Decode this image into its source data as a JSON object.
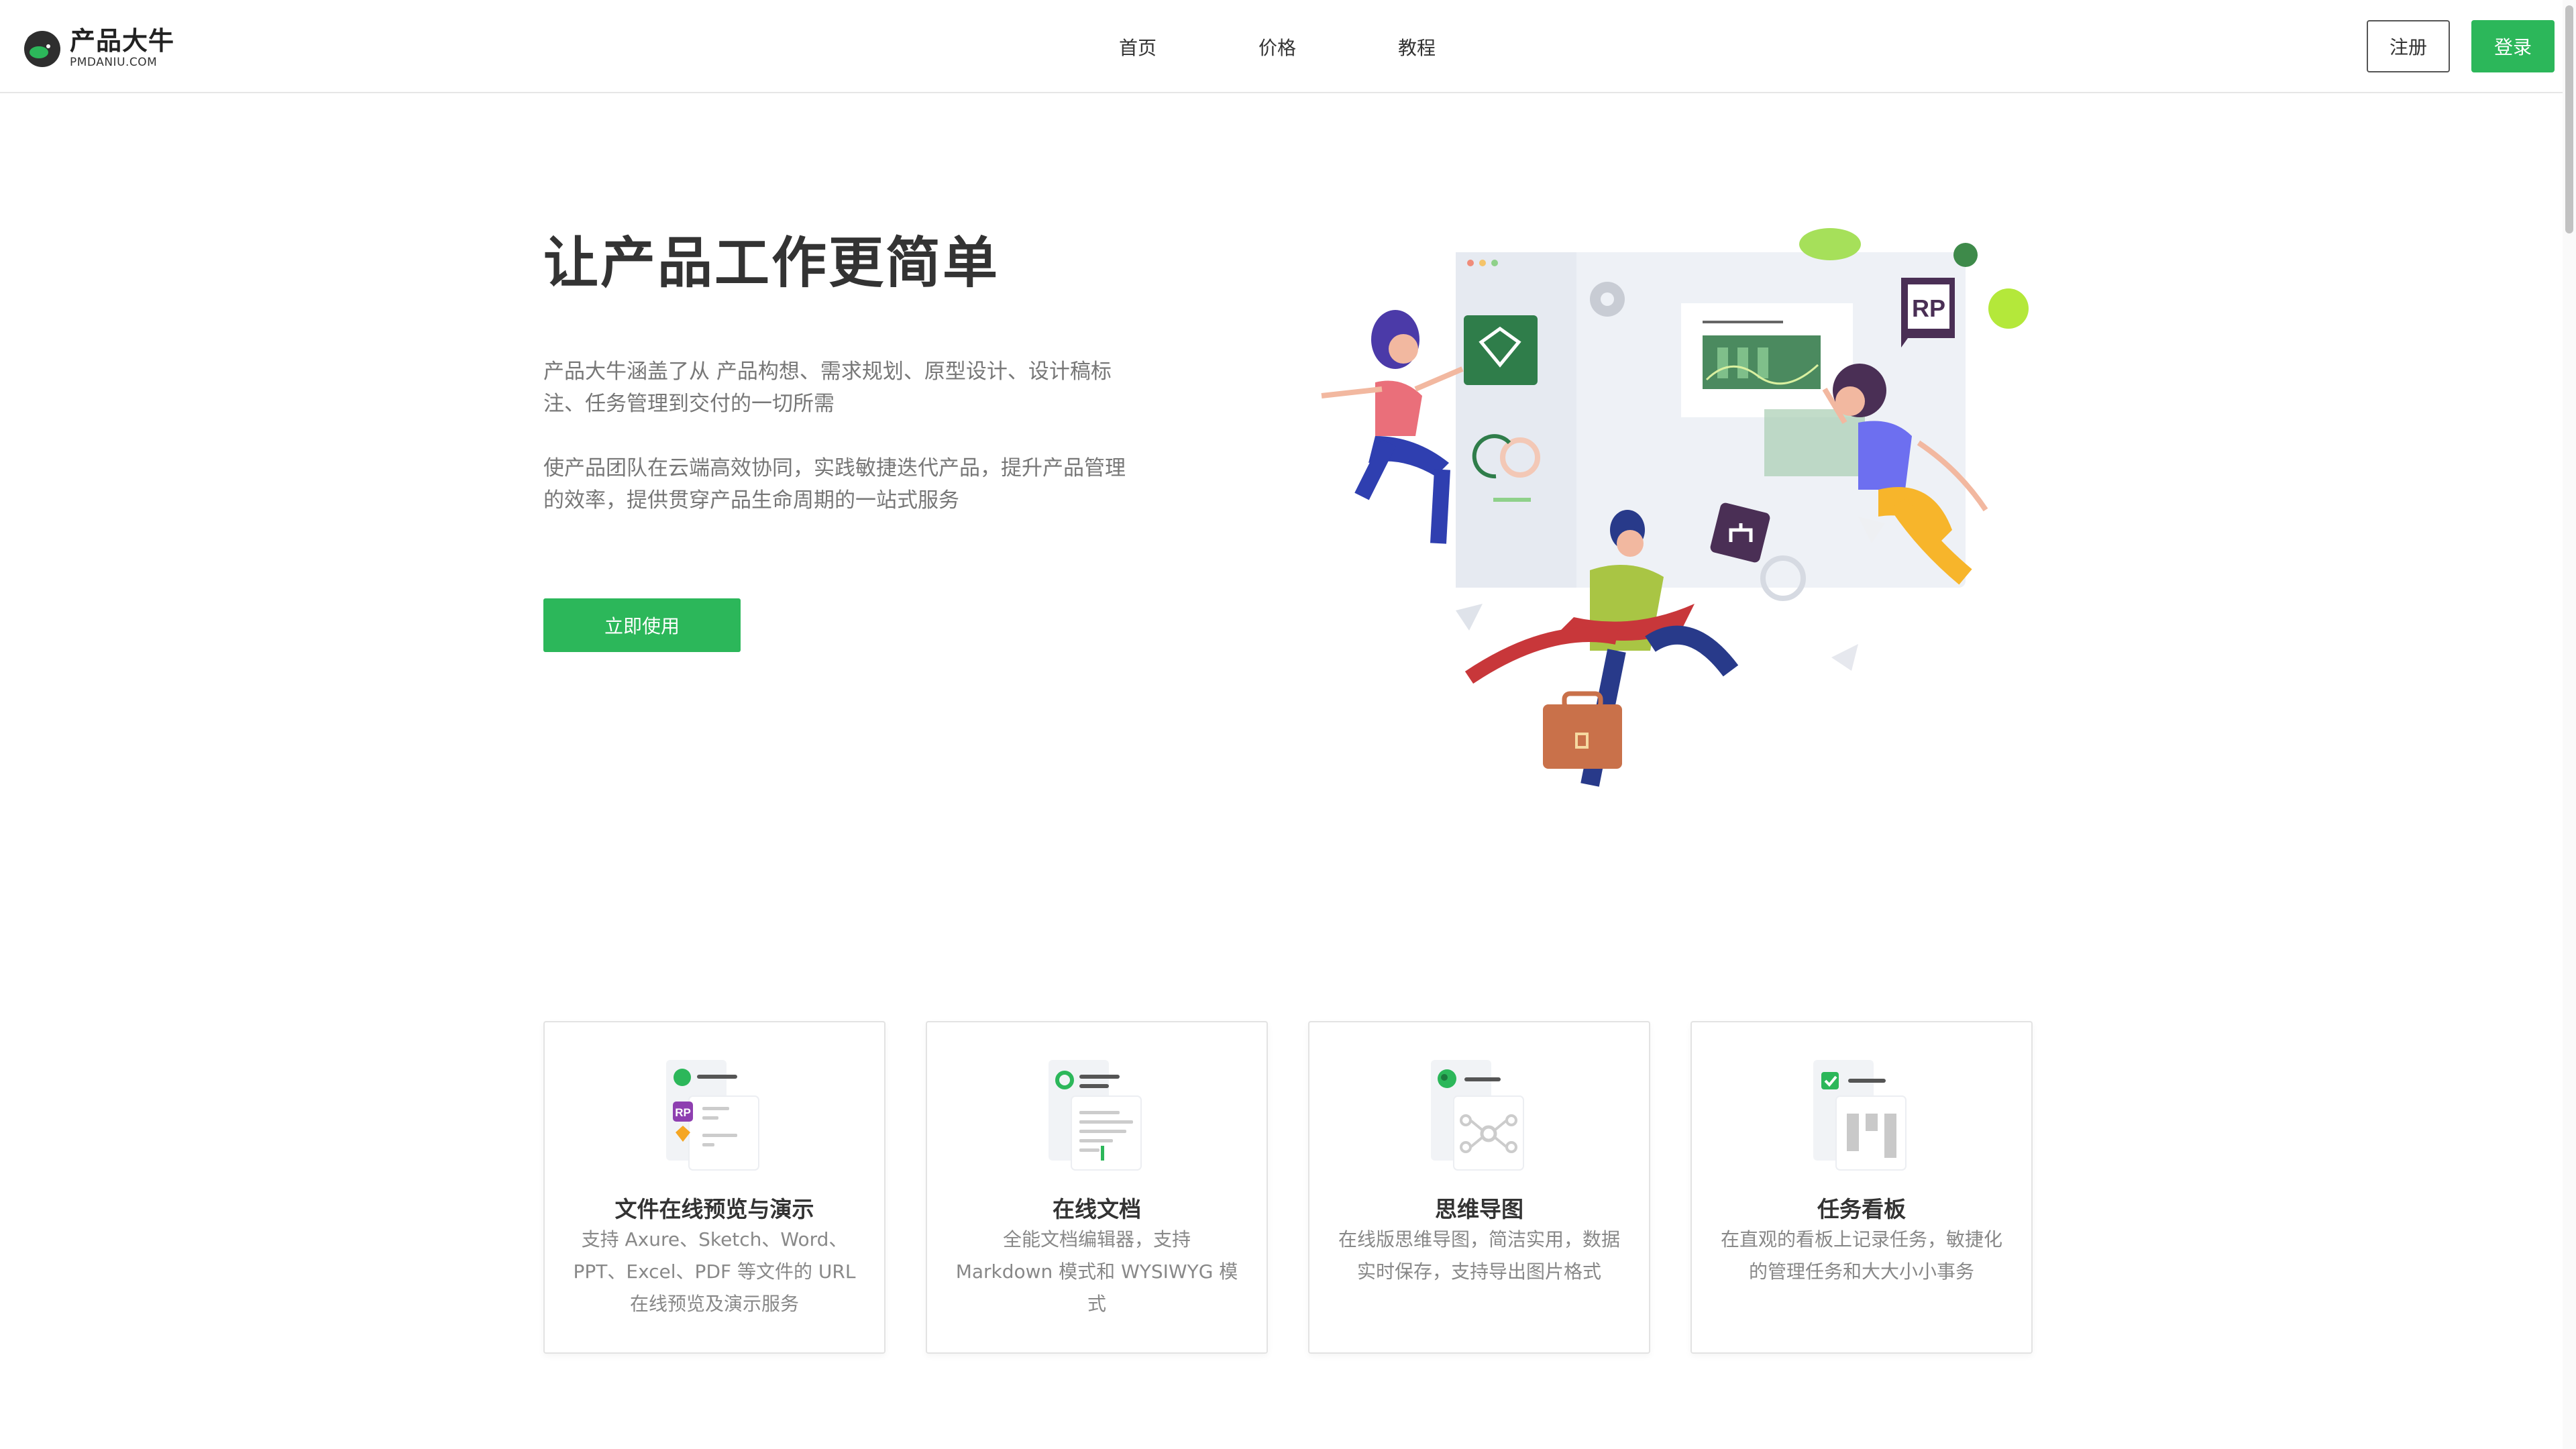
{
  "brand": {
    "name_cn": "产品大牛",
    "name_en": "PMDANIU.COM",
    "color": "#2cb75a"
  },
  "nav": {
    "items": [
      {
        "label": "首页"
      },
      {
        "label": "价格"
      },
      {
        "label": "教程"
      }
    ],
    "register_label": "注册",
    "login_label": "登录"
  },
  "hero": {
    "title": "让产品工作更简单",
    "paragraph_1": "产品大牛涵盖了从 产品构想、需求规划、原型设计、设计稿标注、任务管理到交付的一切所需",
    "paragraph_2": "使产品团队在云端高效协同，实践敏捷迭代产品，提升产品管理的效率，提供贯穿产品生命周期的一站式服务",
    "cta_label": "立即使用",
    "illustration_badge": "RP"
  },
  "features": [
    {
      "title": "文件在线预览与演示",
      "description": "支持 Axure、Sketch、Word、PPT、Excel、PDF 等文件的 URL 在线预览及演示服务",
      "icon": "file-preview-icon",
      "badge": "RP"
    },
    {
      "title": "在线文档",
      "description": "全能文档编辑器，支持 Markdown 模式和 WYSIWYG 模式",
      "icon": "document-icon"
    },
    {
      "title": "思维导图",
      "description": "在线版思维导图，简洁实用，数据实时保存，支持导出图片格式",
      "icon": "mindmap-icon"
    },
    {
      "title": "任务看板",
      "description": "在直观的看板上记录任务，敏捷化的管理任务和大大小小事务",
      "icon": "kanban-icon"
    }
  ]
}
